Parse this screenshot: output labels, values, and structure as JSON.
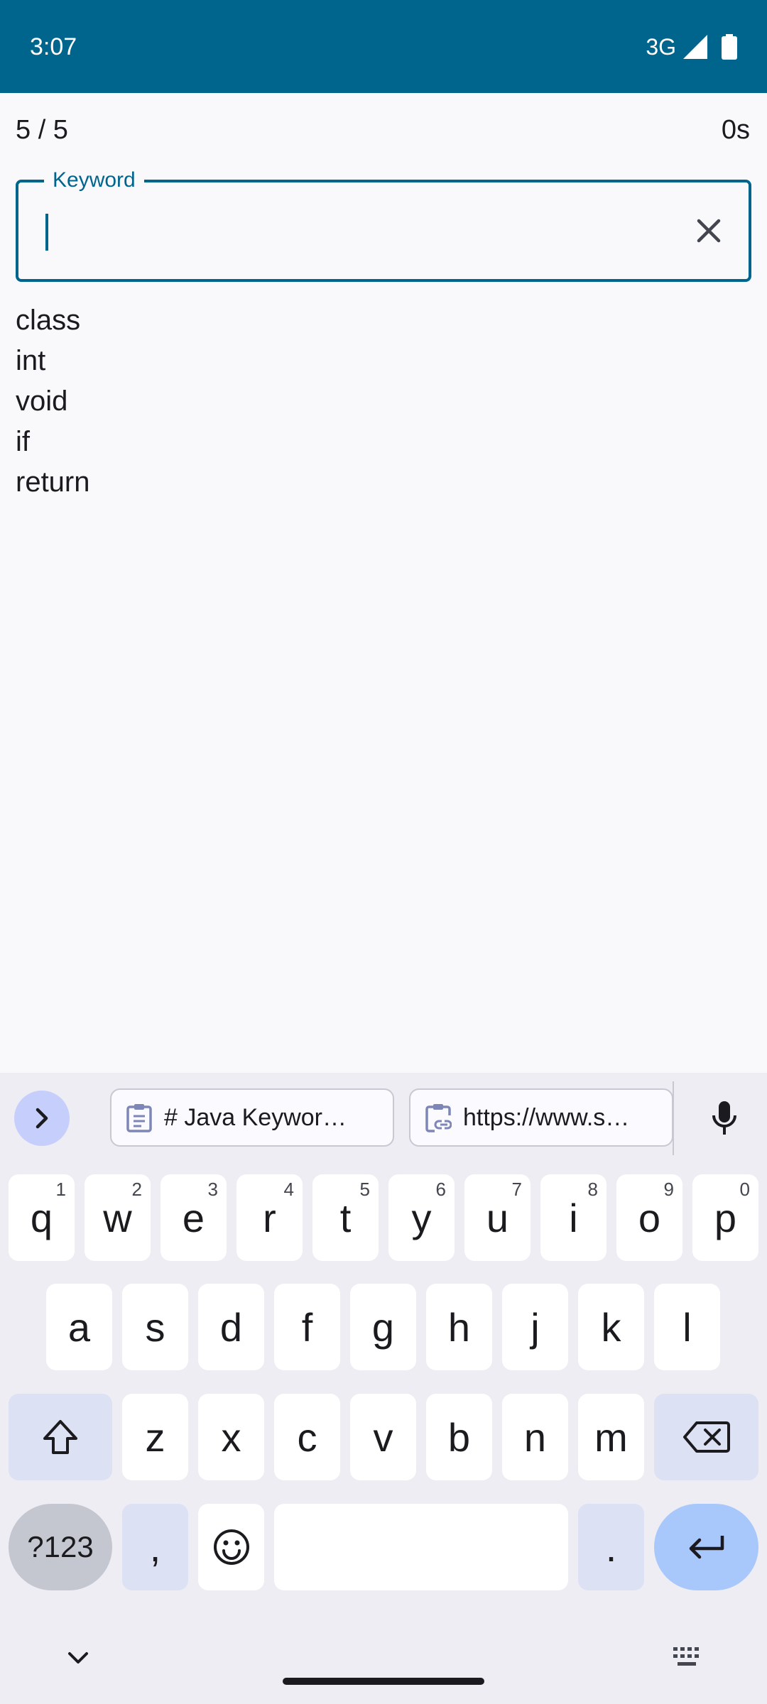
{
  "status_bar": {
    "time": "3:07",
    "network": "3G",
    "background": "#00658d"
  },
  "header": {
    "progress": "5 / 5",
    "elapsed": "0s"
  },
  "search": {
    "label": "Keyword",
    "value": "",
    "placeholder": "",
    "clear_icon": "close-icon"
  },
  "keywords": [
    "class",
    "int",
    "void",
    "if",
    "return"
  ],
  "keyboard": {
    "clipboard": [
      {
        "text": "# Java Keywor…",
        "icon": "clipboard-text-icon"
      },
      {
        "text": "https://www.s…",
        "icon": "clipboard-link-icon"
      }
    ],
    "row1": [
      {
        "key": "q",
        "hint": "1"
      },
      {
        "key": "w",
        "hint": "2"
      },
      {
        "key": "e",
        "hint": "3"
      },
      {
        "key": "r",
        "hint": "4"
      },
      {
        "key": "t",
        "hint": "5"
      },
      {
        "key": "y",
        "hint": "6"
      },
      {
        "key": "u",
        "hint": "7"
      },
      {
        "key": "i",
        "hint": "8"
      },
      {
        "key": "o",
        "hint": "9"
      },
      {
        "key": "p",
        "hint": "0"
      }
    ],
    "row2": [
      "a",
      "s",
      "d",
      "f",
      "g",
      "h",
      "j",
      "k",
      "l"
    ],
    "row3": [
      "z",
      "x",
      "c",
      "v",
      "b",
      "n",
      "m"
    ],
    "symbols_label": "?123",
    "comma": ",",
    "period": ".",
    "accent": "#00658d"
  }
}
